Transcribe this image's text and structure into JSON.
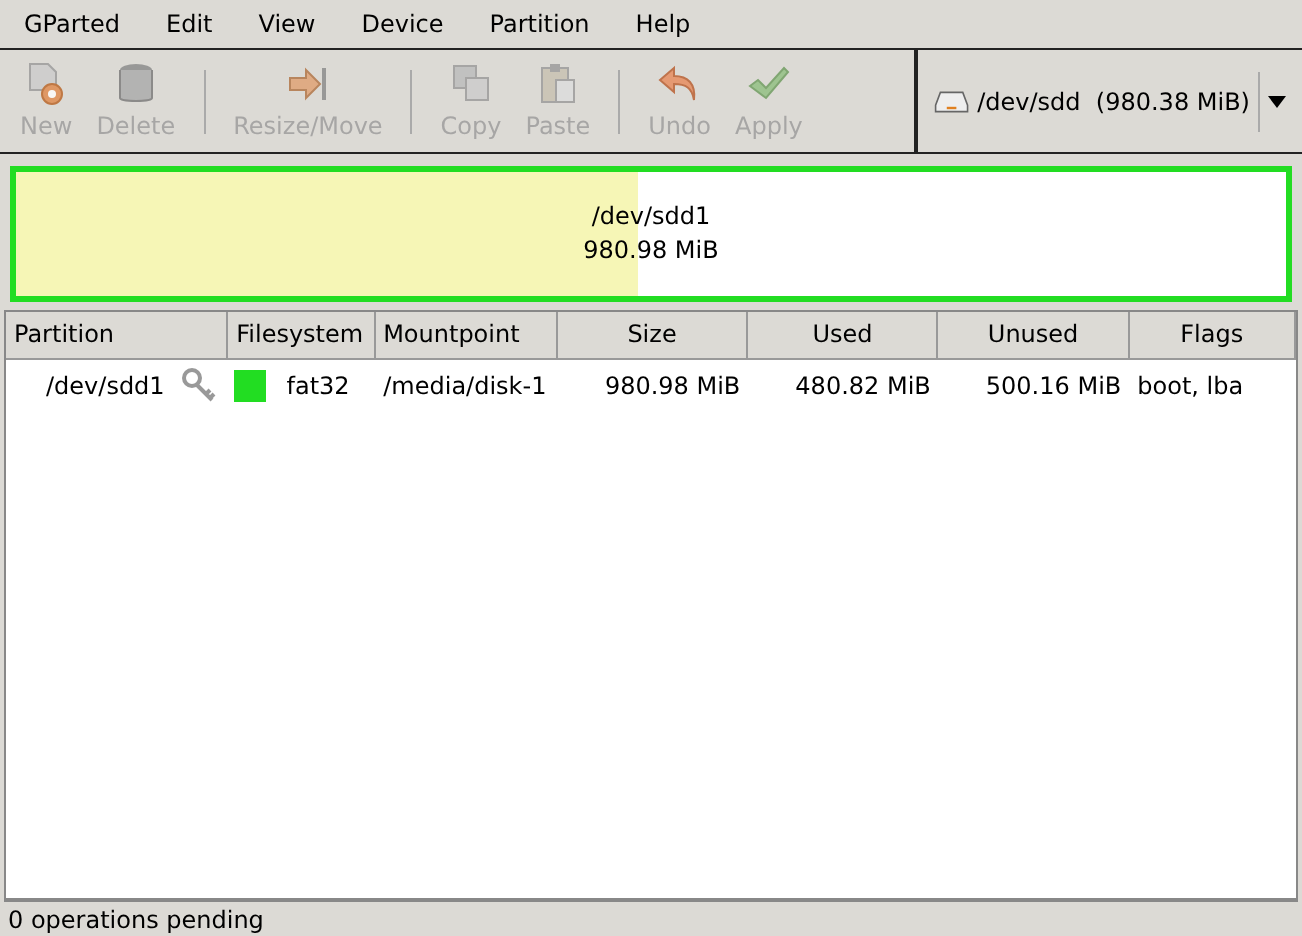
{
  "menu": [
    "GParted",
    "Edit",
    "View",
    "Device",
    "Partition",
    "Help"
  ],
  "toolbar": [
    {
      "kind": "new",
      "label": "New",
      "disabled": true
    },
    {
      "kind": "delete",
      "label": "Delete",
      "disabled": true
    },
    {
      "kind": "separator"
    },
    {
      "kind": "resize",
      "label": "Resize/Move",
      "disabled": true
    },
    {
      "kind": "separator"
    },
    {
      "kind": "copy",
      "label": "Copy",
      "disabled": true
    },
    {
      "kind": "paste",
      "label": "Paste",
      "disabled": true
    },
    {
      "kind": "separator"
    },
    {
      "kind": "undo",
      "label": "Undo",
      "disabled": true
    },
    {
      "kind": "apply",
      "label": "Apply",
      "disabled": true
    }
  ],
  "device": {
    "name": "/dev/sdd",
    "size": "(980.38 MiB)"
  },
  "map": {
    "name": "/dev/sdd1",
    "size": "980.98 MiB",
    "level": 0.49,
    "selected": true
  },
  "table": {
    "columns": [
      "Partition",
      "Filesystem",
      "Mountpoint",
      "Size",
      "Used",
      "Unused",
      "Flags"
    ],
    "rows": [
      {
        "partition": "/dev/sdd1",
        "mounted": true,
        "color": "#22dd22",
        "filesystem": "fat32",
        "mountpoint": "/media/disk-1",
        "size": "980.98 MiB",
        "used": "480.82 MiB",
        "unused": "500.16 MiB",
        "flags": "boot, lba"
      }
    ]
  },
  "status_bar": "0 operations pending"
}
